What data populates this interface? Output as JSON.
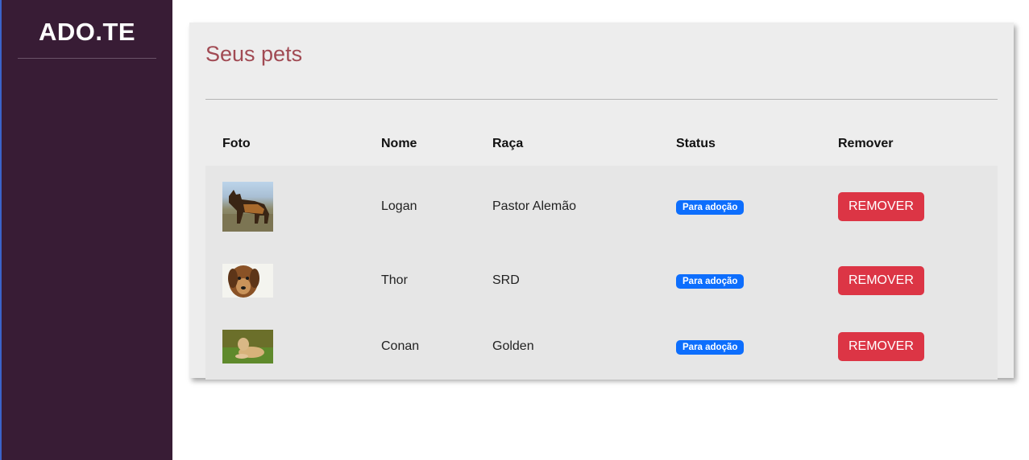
{
  "sidebar": {
    "brand": "ADO.TE"
  },
  "card": {
    "title": "Seus pets"
  },
  "table": {
    "headers": [
      "Foto",
      "Nome",
      "Raça",
      "Status",
      "Remover"
    ],
    "rows": [
      {
        "photo": "german-shepherd-photo",
        "name": "Logan",
        "breed": "Pastor Alemão",
        "status": "Para adoção",
        "remove": "REMOVER"
      },
      {
        "photo": "mixed-breed-dog-photo",
        "name": "Thor",
        "breed": "SRD",
        "status": "Para adoção",
        "remove": "REMOVER"
      },
      {
        "photo": "golden-retriever-photo",
        "name": "Conan",
        "breed": "Golden",
        "status": "Para adoção",
        "remove": "REMOVER"
      }
    ]
  },
  "colors": {
    "sidebar": "#381c35",
    "title": "#a14a53",
    "badge": "#0d6efd",
    "remove_button": "#dc3545",
    "card": "#ededed"
  }
}
